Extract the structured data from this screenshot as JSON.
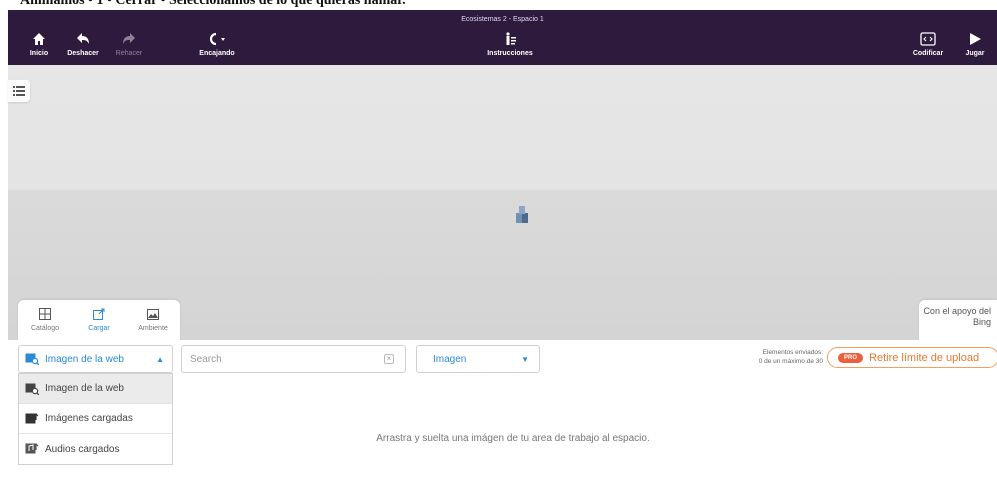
{
  "caption": "Animamos • 1 • Cerrar • Seleccionamos de lo que quieras llamar.",
  "toolbar": {
    "title": "Ecosistemas 2 - Espacio 1",
    "home": "Inicio",
    "undo": "Deshacer",
    "redo": "Rehacer",
    "snapping": "Encajando",
    "instructions": "Instrucciones",
    "code": "Codificar",
    "play": "Jugar"
  },
  "tabs": {
    "catalog": "Catálogo",
    "upload": "Cargar",
    "environment": "Ambiente"
  },
  "bing": "Con el apoyo del Bing",
  "panel": {
    "source_selected": "Imagen de la web",
    "search_placeholder": "Search",
    "type_selected": "Imagen",
    "sent_line1": "Elementos enviados:",
    "sent_line2": "0 de un máximo de 30",
    "pro_badge": "PRO",
    "pro_label": "Retire límite de upload",
    "drop_hint": "Arrastra y suelta una imágen de tu area de trabajo al espacio."
  },
  "dropdown": {
    "items": [
      {
        "label": "Imagen de la web"
      },
      {
        "label": "Imágenes cargadas"
      },
      {
        "label": "Audios cargados"
      }
    ]
  },
  "colors": {
    "toolbar_bg": "#2e1a3c",
    "accent_blue": "#2b8ad6",
    "pro_orange": "#e9792f"
  }
}
